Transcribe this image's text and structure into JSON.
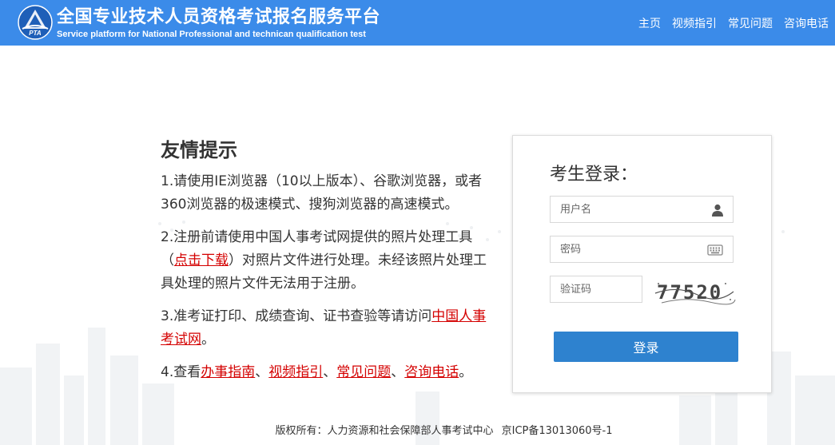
{
  "header": {
    "title": "全国专业技术人员资格考试报名服务平台",
    "subtitle": "Service platform for National Professional and technican qualification test",
    "logo_text": "PTA",
    "nav": [
      {
        "label": "主页"
      },
      {
        "label": "视频指引"
      },
      {
        "label": "常见问题"
      },
      {
        "label": "咨询电话"
      }
    ]
  },
  "tips": {
    "heading": "友情提示",
    "item1": "1.请使用IE浏览器（10以上版本）、谷歌浏览器，或者360浏览器的极速模式、搜狗浏览器的高速模式。",
    "item2_before": "2.注册前请使用中国人事考试网提供的照片处理工具（",
    "item2_link": "点击下载",
    "item2_after": "）对照片文件进行处理。未经该照片处理工具处理的照片文件无法用于注册。",
    "item3_before": "3.准考证打印、成绩查询、证书查验等请访问",
    "item3_link": "中国人事考试网",
    "item3_after": "。",
    "item4_before": "4.查看",
    "item4_link1": "办事指南",
    "sep": "、",
    "item4_link2": "视频指引",
    "item4_link3": "常见问题",
    "item4_link4": "咨询电话",
    "item4_after": "。"
  },
  "login": {
    "title": "考生登录：",
    "username_placeholder": "用户名",
    "username_icon": "user-icon",
    "password_placeholder": "密码",
    "password_icon": "keyboard-icon",
    "captcha_placeholder": "验证码",
    "captcha_text": "77520",
    "button_label": "登录"
  },
  "footer": {
    "copyright": "版权所有：人力资源和社会保障部人事考试中心",
    "icp": "京ICP备13013060号-1"
  },
  "colors": {
    "header_bg": "#3b8be9",
    "link_red": "#d40000",
    "button_blue": "#2e82cf"
  }
}
